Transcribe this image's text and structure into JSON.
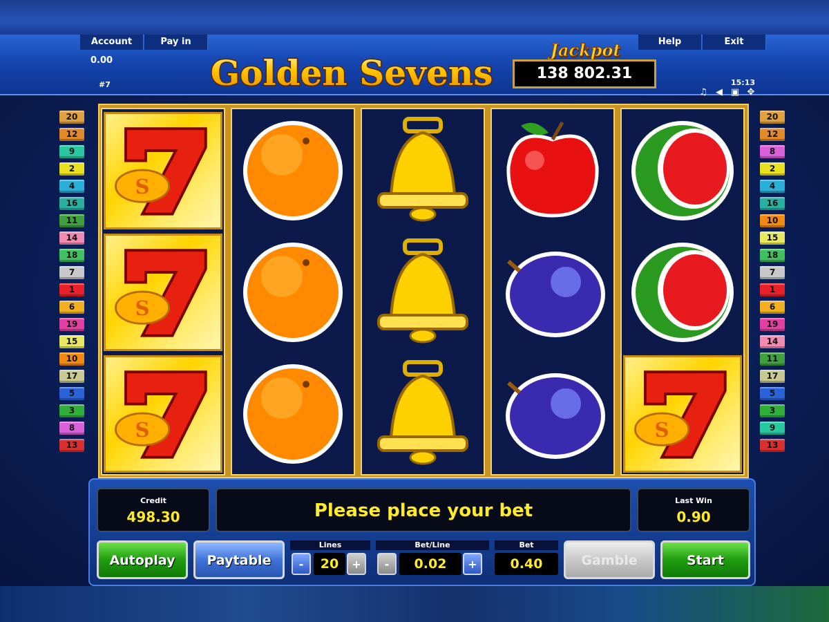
{
  "header": {
    "menu": {
      "account": "Account",
      "pay_in": "Pay in",
      "help": "Help",
      "exit": "Exit"
    },
    "balance": "0.00",
    "game_number": "#7",
    "time": "15:13",
    "title": "Golden Sevens",
    "jackpot_label": "Jackpot",
    "jackpot_value": "138 802.31",
    "icons": [
      "music-icon",
      "speaker-icon",
      "window-icon",
      "fullscreen-icon"
    ]
  },
  "paylines": {
    "left": [
      "20",
      "12",
      "9",
      "2",
      "4",
      "16",
      "11",
      "14",
      "18",
      "7",
      "1",
      "6",
      "19",
      "15",
      "10",
      "17",
      "5",
      "3",
      "8",
      "13"
    ],
    "right": [
      "20",
      "12",
      "8",
      "2",
      "4",
      "16",
      "10",
      "15",
      "18",
      "7",
      "1",
      "6",
      "19",
      "14",
      "11",
      "17",
      "5",
      "3",
      "9",
      "13"
    ]
  },
  "reels": [
    [
      "seven",
      "seven",
      "seven"
    ],
    [
      "orange",
      "orange",
      "orange"
    ],
    [
      "bell",
      "bell",
      "bell"
    ],
    [
      "apple",
      "plum",
      "plum"
    ],
    [
      "watermelon",
      "watermelon",
      "seven"
    ]
  ],
  "console": {
    "credit_label": "Credit",
    "credit_value": "498.30",
    "message": "Please place your bet",
    "last_win_label": "Last Win",
    "last_win_value": "0.90",
    "autoplay": "Autoplay",
    "paytable": "Paytable",
    "lines_label": "Lines",
    "lines_value": "20",
    "bet_line_label": "Bet/Line",
    "bet_line_value": "0.02",
    "bet_label": "Bet",
    "bet_value": "0.40",
    "gamble": "Gamble",
    "start": "Start",
    "minus": "-",
    "plus": "+"
  },
  "colors": {
    "accent_yellow": "#ffeb2a",
    "gold": "#c79424",
    "header_blue": "#1646b0",
    "button_green": "#1f9d10"
  }
}
